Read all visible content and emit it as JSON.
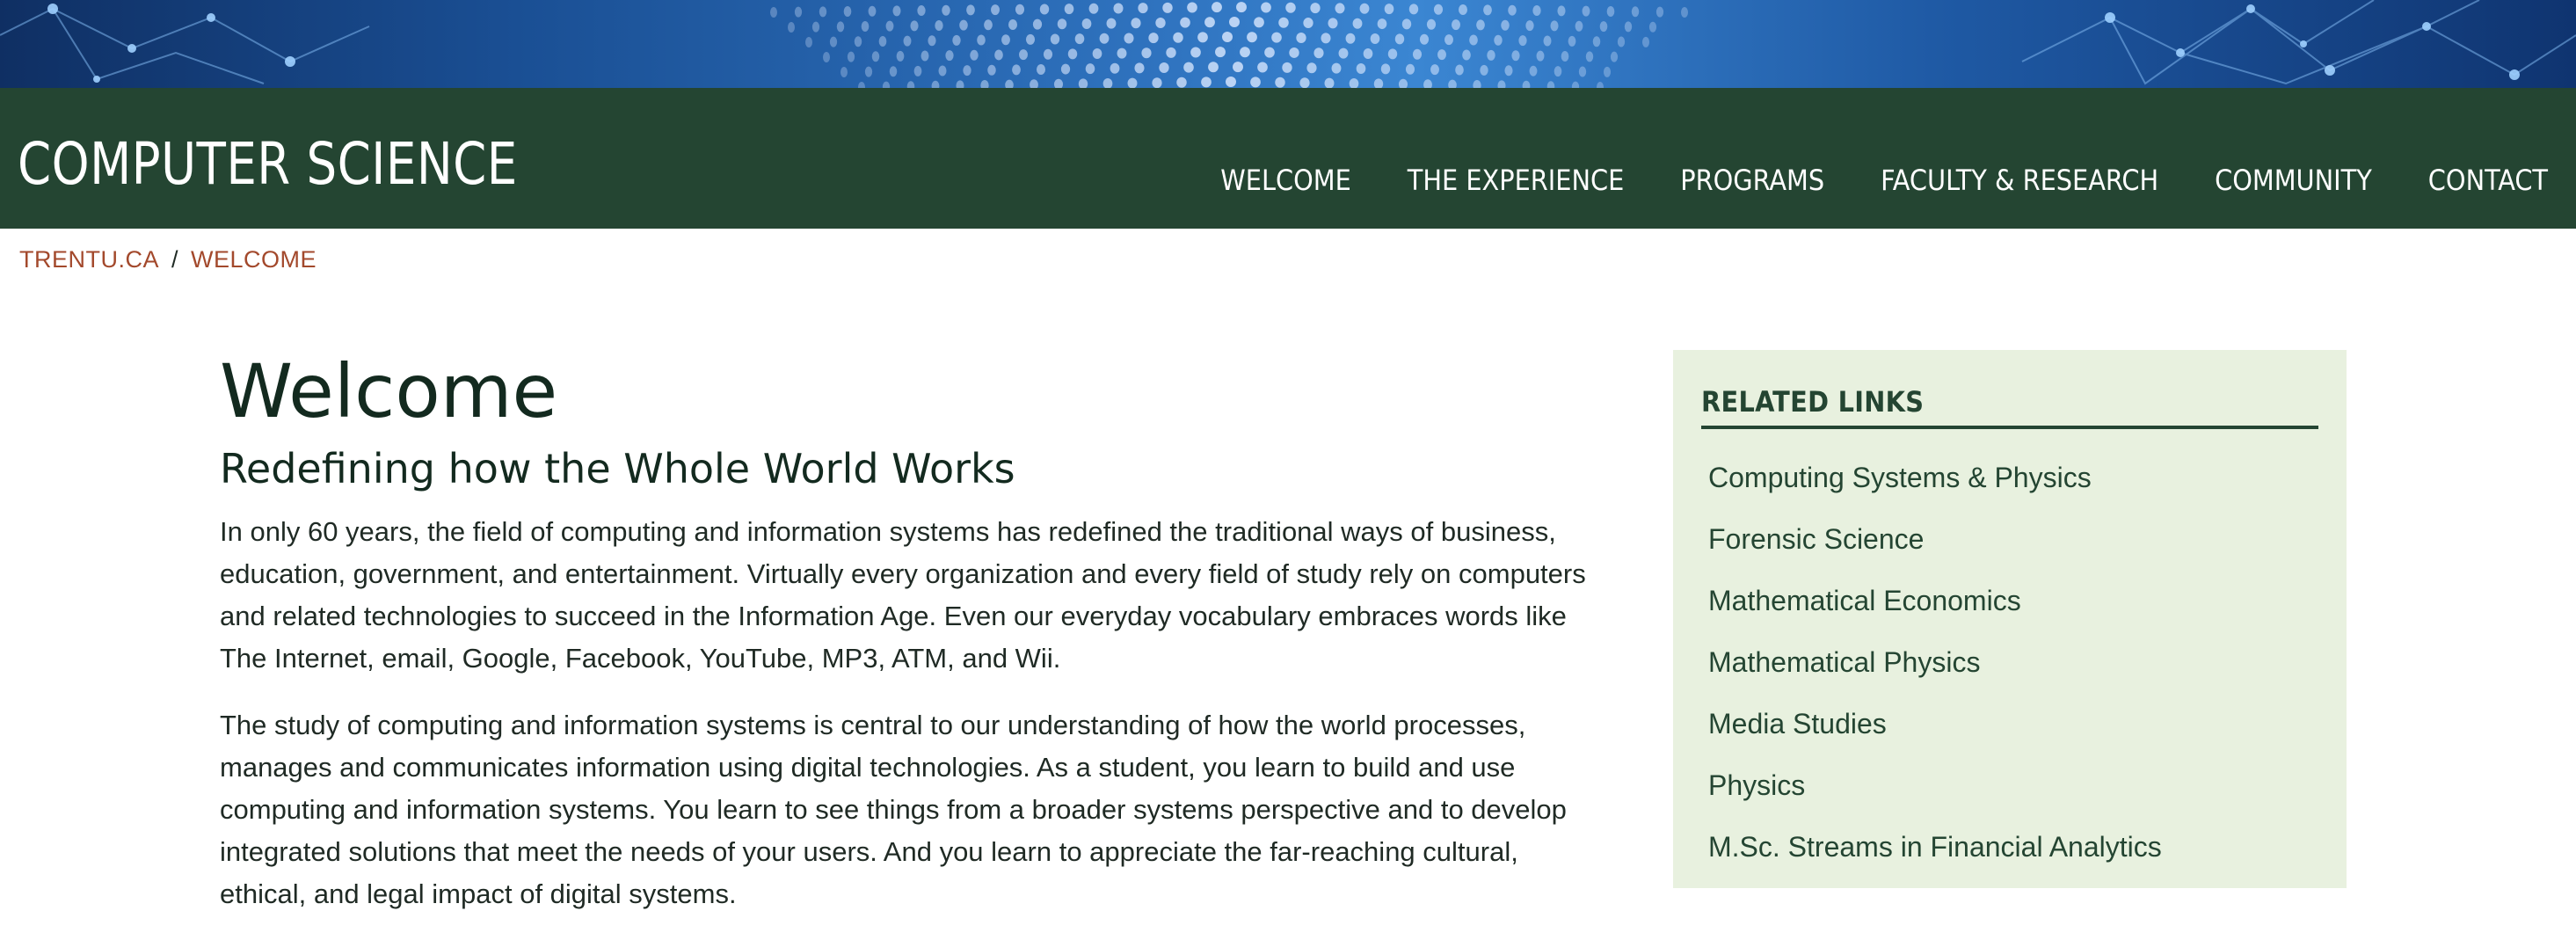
{
  "header": {
    "site_title": "COMPUTER SCIENCE",
    "nav": [
      "WELCOME",
      "THE EXPERIENCE",
      "PROGRAMS",
      "FACULTY & RESEARCH",
      "COMMUNITY",
      "CONTACT"
    ],
    "background_color": "#244532"
  },
  "breadcrumb": {
    "items": [
      "TRENTU.CA",
      "WELCOME"
    ],
    "separator": "/",
    "link_color": "#a3492c"
  },
  "main": {
    "title": "Welcome",
    "subtitle": "Redefining how the Whole World Works",
    "paragraphs": [
      "In only 60 years, the field of computing and information systems has redefined the traditional ways of business, education, government, and entertainment.  Virtually every organization and every field of study rely on computers and related technologies to succeed in the Information Age.  Even our everyday vocabulary embraces words like The Internet, email, Google, Facebook, YouTube, MP3, ATM, and Wii.",
      "The study of computing and information systems is central to our understanding of how the world processes, manages and communicates information using digital technologies.  As a student, you learn to build and use computing and information systems.  You learn to see things from a broader systems perspective and to develop integrated solutions that meet the needs of your users.  And you learn to appreciate the far-reaching cultural, ethical, and legal impact of digital systems."
    ]
  },
  "sidebar": {
    "heading": "RELATED LINKS",
    "links": [
      "Computing Systems & Physics",
      "Forensic Science",
      "Mathematical Economics",
      "Mathematical Physics",
      "Media Studies",
      "Physics",
      "M.Sc. Streams in Financial Analytics"
    ],
    "background_color": "#e8f1df"
  }
}
